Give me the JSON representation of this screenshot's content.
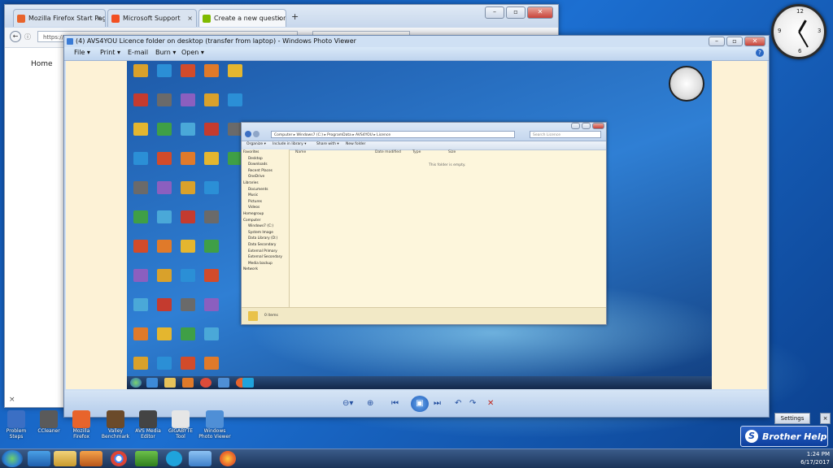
{
  "firefox": {
    "tabs": [
      {
        "label": "Mozilla Firefox Start Page",
        "close": "×"
      },
      {
        "label": "Microsoft Support",
        "close": "×"
      },
      {
        "label": "Create a new question or...",
        "close": "×"
      }
    ],
    "new_tab": "+",
    "url": "https://",
    "home_label": "Home",
    "bottom_close": "×"
  },
  "photo_viewer": {
    "title": "(4) AVS4YOU Licence folder on desktop (transfer from laptop) - Windows Photo Viewer",
    "menu": [
      "File ▾",
      "Print ▾",
      "E-mail",
      "Burn ▾",
      "Open ▾"
    ],
    "help": "?",
    "controls": [
      "⊖▾",
      "⊕",
      "⏮",
      "▣",
      "⏭",
      "↶",
      "↷",
      "✕"
    ]
  },
  "inner_explorer": {
    "address": "Computer ▸ Windows7 (C:) ▸ ProgramData ▸ AVS4YOU ▸ Licence",
    "search_placeholder": "Search Licence",
    "toolbar": [
      "Organize ▾",
      "Include in library ▾",
      "Share with ▾",
      "New folder"
    ],
    "columns": [
      "Name",
      "Date modified",
      "Type",
      "Size"
    ],
    "empty_text": "This folder is empty.",
    "nav": [
      "Favorites",
      "Desktop",
      "Downloads",
      "Recent Places",
      "OneDrive",
      "",
      "Libraries",
      "Documents",
      "Music",
      "Pictures",
      "Videos",
      "",
      "Homegroup",
      "",
      "Computer",
      "Windows7 (C:)",
      "System Image",
      "Data Library (D:)",
      "Data Secondary",
      "External Primary",
      "External Secondary",
      "Media backup",
      "",
      "Network"
    ],
    "status": "0 items"
  },
  "bottom_icons": [
    {
      "label": "Problem Steps",
      "color": "#3b6fc4"
    },
    {
      "label": "CCleaner",
      "color": "#5a5a5a"
    },
    {
      "label": "Mozilla Firefox",
      "color": "#e8642c"
    },
    {
      "label": "Valley Benchmark",
      "color": "#6b4a2a"
    },
    {
      "label": "AVS Media Editor",
      "color": "#444"
    },
    {
      "label": "GIGABYTE Tool",
      "color": "#e6e6e6"
    },
    {
      "label": "Windows Photo Viewer",
      "color": "#4f8fd6"
    }
  ],
  "brother_help": {
    "settings": "Settings",
    "close": "×",
    "label": "Brother Help",
    "logo": "S"
  },
  "tray": {
    "time": "1:24 PM",
    "date": "6/17/2017"
  }
}
